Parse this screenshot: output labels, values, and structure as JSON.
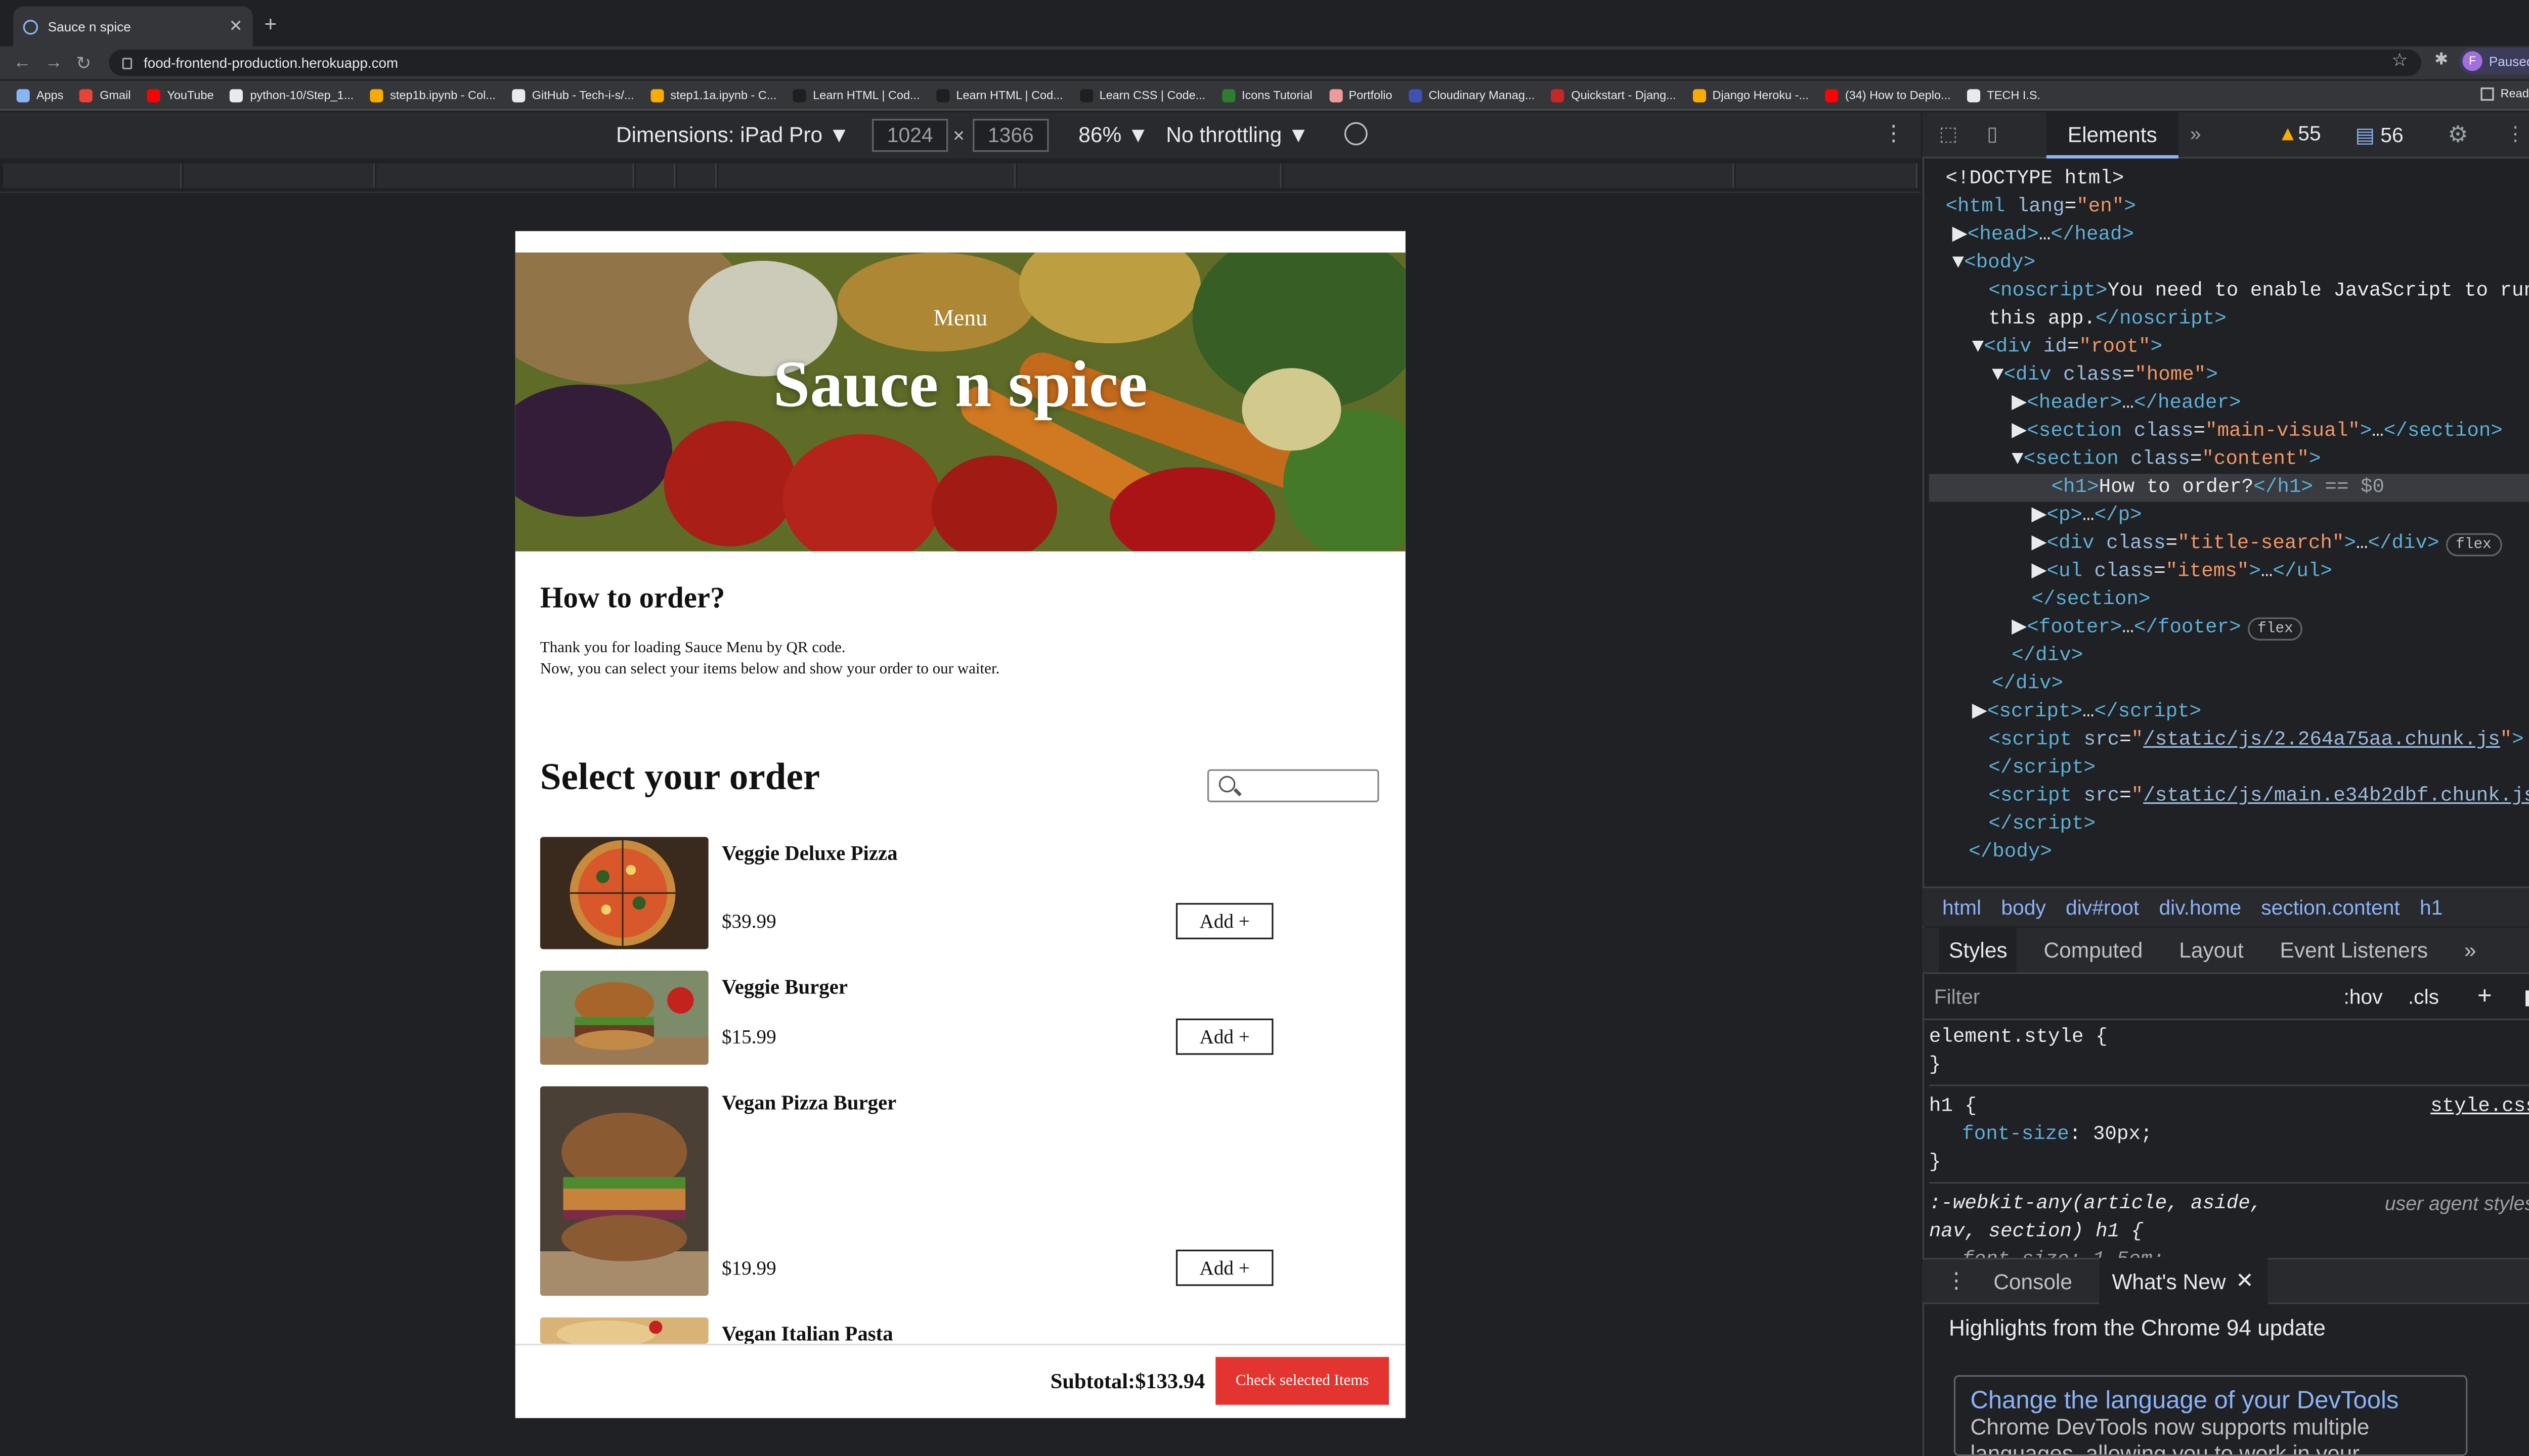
{
  "browser": {
    "tab_title": "Sauce n spice",
    "url": "food-frontend-production.herokuapp.com",
    "profile_initial": "F",
    "profile_status": "Paused",
    "bookmarks": [
      "Apps",
      "Gmail",
      "YouTube",
      "python-10/Step_1...",
      "step1b.ipynb - Col...",
      "GitHub - Tech-i-s/...",
      "step1.1a.ipynb - C...",
      "Learn HTML | Cod...",
      "Learn HTML | Cod...",
      "Learn CSS | Code...",
      "Icons Tutorial",
      "Portfolio",
      "Cloudinary Manag...",
      "Quickstart - Djang...",
      "Django Heroku -...",
      "(34) How to Deplo...",
      "TECH I.S."
    ],
    "reading_list": "Reading List"
  },
  "device_toolbar": {
    "dimensions": "Dimensions: iPad Pro",
    "width": "1024",
    "height": "1366",
    "times": "×",
    "zoom": "86%",
    "throttling": "No throttling"
  },
  "page": {
    "menu_label": "Menu",
    "brand": "Sauce n spice",
    "how_title": "How to order?",
    "intro_line1": "Thank you for loading Sauce Menu by QR code.",
    "intro_line2": "Now, you can select your items below and show your order to our waiter.",
    "select_title": "Select your order",
    "add_label": "Add +",
    "items": [
      {
        "name": "Veggie Deluxe Pizza",
        "price": "$39.99"
      },
      {
        "name": "Veggie Burger",
        "price": "$15.99"
      },
      {
        "name": "Vegan Pizza Burger",
        "price": "$19.99"
      },
      {
        "name": "Vegan Italian Pasta",
        "price": ""
      }
    ],
    "subtotal": "Subtotal:$133.94",
    "check_button": "Check selected Items"
  },
  "devtools": {
    "elements_tab": "Elements",
    "warnings": "55",
    "messages": "56",
    "crumbs": [
      "html",
      "body",
      "div#root",
      "div.home",
      "section.content",
      "h1"
    ],
    "subtabs": [
      "Styles",
      "Computed",
      "Layout",
      "Event Listeners"
    ],
    "filter_placeholder": "Filter",
    "hov": ":hov",
    "cls": ".cls",
    "drawer_tabs": [
      "Console",
      "What's New"
    ],
    "whatsnew_heading": "Highlights from the Chrome 94 update",
    "card_title": "Change the language of your DevTools",
    "card_body": "Chrome DevTools now supports multiple languages, allowing you to work in your"
  },
  "colors": {
    "check_button": "#e3342f",
    "devtools_bg": "#202124",
    "accent_link": "#8ab4f8"
  }
}
